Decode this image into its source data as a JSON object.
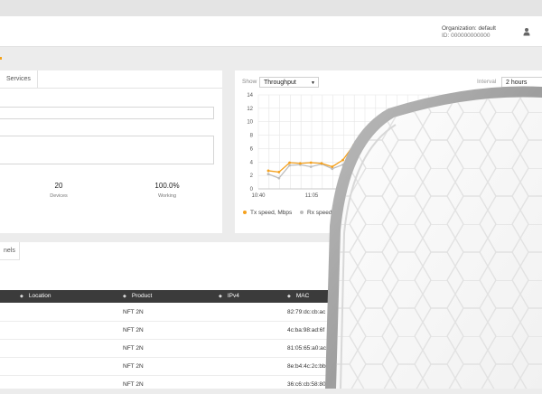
{
  "header": {
    "org_line": "Organization: default",
    "id_line": "ID: 000000000000"
  },
  "left_panel": {
    "tab_services": "Services",
    "stats": [
      {
        "value": "20",
        "label": "Devices"
      },
      {
        "value": "100.0%",
        "label": "Working"
      }
    ]
  },
  "chart_panel": {
    "show_label": "Show",
    "show_value": "Throughput",
    "interval_label": "Interval",
    "interval_value": "2 hours",
    "legend": [
      {
        "label": "Tx speed, Mbps",
        "color": "#f5a11d"
      },
      {
        "label": "Rx speed",
        "color": "#bdbdbd"
      }
    ]
  },
  "chart_data": {
    "type": "line",
    "x": [
      "10:40",
      "10:45",
      "10:50",
      "10:55",
      "11:00",
      "11:05",
      "11:10",
      "11:15",
      "11:20",
      "11:25"
    ],
    "xticks": [
      "10:40",
      "11:05"
    ],
    "yticks": [
      0,
      2,
      4,
      6,
      8,
      10,
      12,
      14
    ],
    "ylim": [
      0,
      14
    ],
    "series": [
      {
        "name": "Tx speed, Mbps",
        "color": "#f5a11d",
        "values": [
          2.7,
          2.5,
          3.9,
          3.8,
          3.9,
          3.8,
          3.3,
          4.3,
          6.5,
          6.6
        ]
      },
      {
        "name": "Rx speed",
        "color": "#bdbdbd",
        "values": [
          2.2,
          1.6,
          3.5,
          3.6,
          3.3,
          3.7,
          3.0,
          3.6,
          5.5,
          6.0
        ]
      }
    ]
  },
  "bottom_panel": {
    "tab_channels": "nels",
    "columns": [
      "Location",
      "Product",
      "IPv4",
      "MAC"
    ],
    "rows": [
      {
        "product": "NFT 2N",
        "mac": "82:79:dc:cb:ac"
      },
      {
        "product": "NFT 2N",
        "mac": "4c:ba:98:ad:6f"
      },
      {
        "product": "NFT 2N",
        "mac": "81:05:65:a0:ac"
      },
      {
        "product": "NFT 2N",
        "mac": "8e:b4:4c:2c:bb"
      },
      {
        "product": "NFT 2N",
        "mac": "36:c6:cb:58:80"
      }
    ]
  }
}
